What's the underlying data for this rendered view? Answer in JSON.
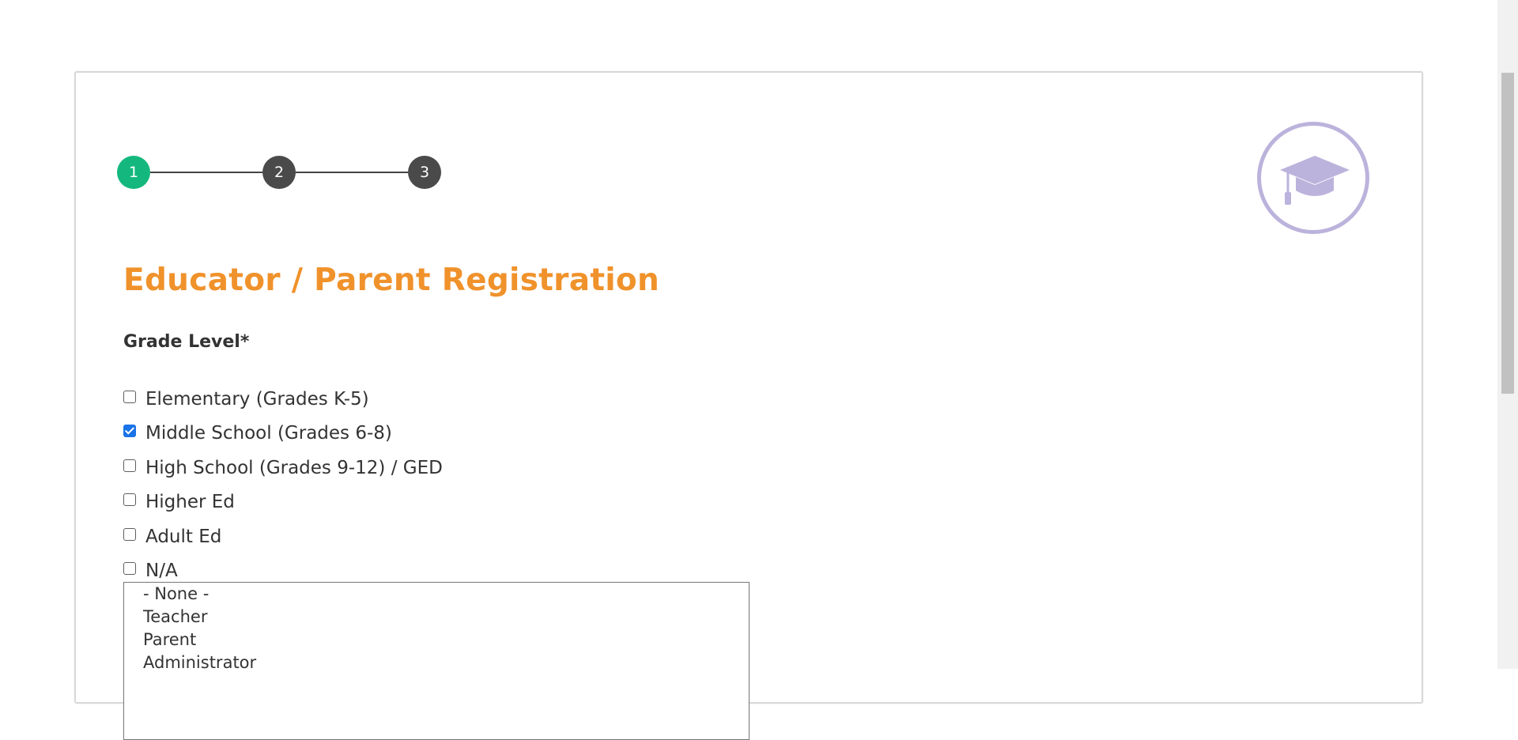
{
  "stepper": {
    "steps": [
      {
        "label": "1",
        "state": "active"
      },
      {
        "label": "2",
        "state": "inactive"
      },
      {
        "label": "3",
        "state": "inactive"
      }
    ],
    "colors": {
      "active": "#14b87e",
      "inactive": "#4a4a4a",
      "line": "#444444"
    }
  },
  "header_icon": {
    "name": "graduation-cap-icon",
    "color": "#bcb3dc"
  },
  "form": {
    "title": "Educator / Parent Registration",
    "title_color": "#f0922b",
    "grade_level": {
      "label": "Grade Level*",
      "options": [
        {
          "label": "Elementary (Grades K-5)",
          "checked": false
        },
        {
          "label": "Middle School (Grades 6-8)",
          "checked": true
        },
        {
          "label": "High School (Grades 9-12) / GED",
          "checked": false
        },
        {
          "label": "Higher Ed",
          "checked": false
        },
        {
          "label": "Adult Ed",
          "checked": false
        },
        {
          "label": "N/A",
          "checked": false
        }
      ]
    },
    "role_select": {
      "options": [
        "- None -",
        "Teacher",
        "Parent",
        "Administrator"
      ]
    }
  },
  "accent_color": "#1a73e8"
}
